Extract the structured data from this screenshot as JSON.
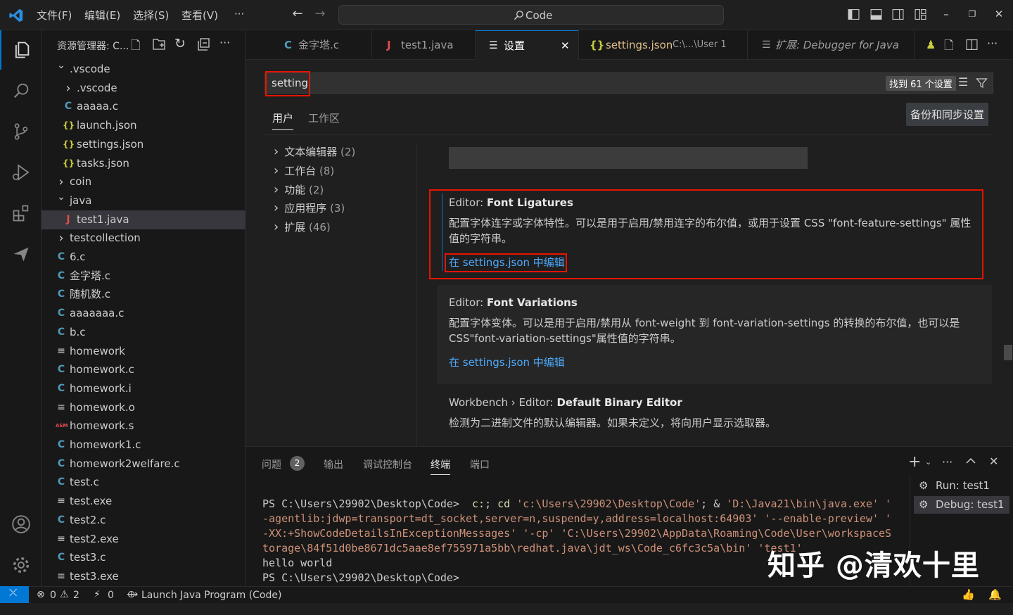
{
  "titlebar": {
    "menus": [
      "文件(F)",
      "编辑(E)",
      "选择(S)",
      "查看(V)",
      "···"
    ],
    "command_center": "Code"
  },
  "sidebar": {
    "title": "资源管理器: C...",
    "items": [
      {
        "label": ".vscode",
        "icon": "chevron-down",
        "indent": 0
      },
      {
        "label": ".vscode",
        "icon": "chevron-right",
        "indent": 1
      },
      {
        "label": "aaaaa.c",
        "icon": "C",
        "indent": 1
      },
      {
        "label": "launch.json",
        "icon": "{}",
        "indent": 1
      },
      {
        "label": "settings.json",
        "icon": "{}",
        "indent": 1
      },
      {
        "label": "tasks.json",
        "icon": "{}",
        "indent": 1
      },
      {
        "label": "coin",
        "icon": "chevron-right",
        "indent": 0
      },
      {
        "label": "java",
        "icon": "chevron-down",
        "indent": 0
      },
      {
        "label": "test1.java",
        "icon": "J",
        "indent": 1
      },
      {
        "label": "testcollection",
        "icon": "chevron-right",
        "indent": 0
      },
      {
        "label": "6.c",
        "icon": "C",
        "indent": 0
      },
      {
        "label": "金字塔.c",
        "icon": "C",
        "indent": 0
      },
      {
        "label": "随机数.c",
        "icon": "C",
        "indent": 0
      },
      {
        "label": "aaaaaaa.c",
        "icon": "C",
        "indent": 0
      },
      {
        "label": "b.c",
        "icon": "C",
        "indent": 0
      },
      {
        "label": "homework",
        "icon": "lines",
        "indent": 0
      },
      {
        "label": "homework.c",
        "icon": "C",
        "indent": 0
      },
      {
        "label": "homework.i",
        "icon": "C",
        "indent": 0
      },
      {
        "label": "homework.o",
        "icon": "lines",
        "indent": 0
      },
      {
        "label": "homework.s",
        "icon": "ASM",
        "indent": 0
      },
      {
        "label": "homework1.c",
        "icon": "C",
        "indent": 0
      },
      {
        "label": "homework2welfare.c",
        "icon": "C",
        "indent": 0
      },
      {
        "label": "test.c",
        "icon": "C",
        "indent": 0
      },
      {
        "label": "test.exe",
        "icon": "lines",
        "indent": 0
      },
      {
        "label": "test2.c",
        "icon": "C",
        "indent": 0
      },
      {
        "label": "test2.exe",
        "icon": "lines",
        "indent": 0
      },
      {
        "label": "test3.c",
        "icon": "C",
        "indent": 0
      },
      {
        "label": "test3.exe",
        "icon": "lines",
        "indent": 0
      }
    ]
  },
  "tabs": [
    {
      "label": "金字塔.c",
      "icon": "C"
    },
    {
      "label": "test1.java",
      "icon": "J"
    },
    {
      "label": "设置",
      "icon": "lines"
    },
    {
      "label": "settings.json",
      "icon": "{}",
      "detail": "C:\\...\\User 1"
    },
    {
      "label": "扩展: Debugger for Java",
      "icon": "lines"
    }
  ],
  "settings": {
    "search_value": "setting",
    "result_count": "找到 61 个设置",
    "scope_tabs": [
      "用户",
      "工作区"
    ],
    "sync_button": "备份和同步设置",
    "toc": [
      {
        "label": "文本编辑器",
        "count": "(2)"
      },
      {
        "label": "工作台",
        "count": "(8)"
      },
      {
        "label": "功能",
        "count": "(2)"
      },
      {
        "label": "应用程序",
        "count": "(3)"
      },
      {
        "label": "扩展",
        "count": "(46)"
      }
    ],
    "entries": [
      {
        "category": "Editor: ",
        "name": "Font Ligatures",
        "desc1": "配置字体连字或字体特性。可以是用于启用/禁用连字的布尔值，或用于设置 CSS \"font-feature-settings\" 属性",
        "desc2": "值的字符串。",
        "link": "在 settings.json 中编辑"
      },
      {
        "category": "Editor: ",
        "name": "Font Variations",
        "desc1": "配置字体变体。可以是用于启用/禁用从 font-weight 到 font-variation-settings 的转换的布尔值，也可以是",
        "desc2": "CSS\"font-variation-settings\"属性值的字符串。",
        "link": "在 settings.json 中编辑"
      },
      {
        "category": "Workbench › Editor: ",
        "name": "Default Binary Editor",
        "desc1": "检测为二进制文件的默认编辑器。如果未定义，将向用户显示选取器。"
      }
    ]
  },
  "panel": {
    "tabs": [
      "问题",
      "输出",
      "调试控制台",
      "终端",
      "端口"
    ],
    "problems_badge": "2",
    "terminal_lines": [
      "PS C:\\Users\\29902\\Desktop\\Code>",
      "-agentlib:jdwp=transport=dt_socket,server=n,suspend=y,address=localhost:64903' '--enable-preview' '",
      "-XX:+ShowCodeDetailsInExceptionMessages' '-cp' 'C:\\Users\\29902\\AppData\\Roaming\\Code\\User\\workspaceS",
      "torage\\84f51d0be8671dc5aae8ef755971a5bb\\redhat.java\\jdt_ws\\Code_c6fc3c5a\\bin' 'test1'",
      "hello world",
      "PS C:\\Users\\29902\\Desktop\\Code>"
    ],
    "cmd_part1": "c:",
    "cmd_part2": "; ",
    "cmd_part3": "cd",
    "cmd_part4": " 'c:\\Users\\29902\\Desktop\\Code'",
    "cmd_part5": "; & ",
    "cmd_part6": "'D:\\Java21\\bin\\java.exe' '",
    "terminals": [
      "Run: test1",
      "Debug: test1"
    ]
  },
  "watermark": "知乎 @清欢十里",
  "statusbar": {
    "errors": "0",
    "warnings": "2",
    "ports": "0",
    "launch": "Launch Java Program (Code)"
  },
  "colors": {
    "accent": "#0078d4",
    "highlight": "#e51400",
    "link": "#4daafc"
  }
}
